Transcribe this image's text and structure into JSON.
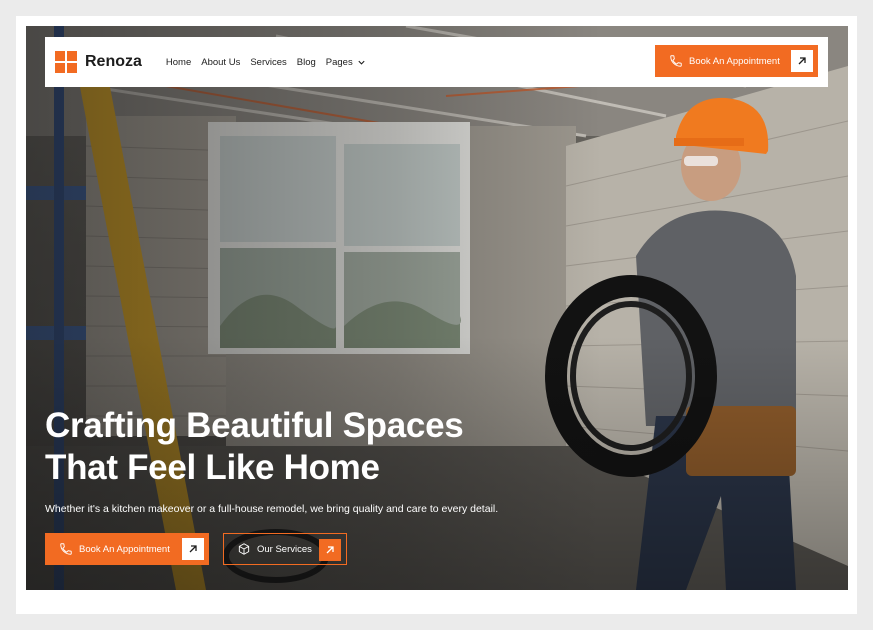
{
  "brand": {
    "name": "Renoza",
    "accent": "#f26b22"
  },
  "nav": {
    "items": [
      {
        "label": "Home"
      },
      {
        "label": "About Us"
      },
      {
        "label": "Services"
      },
      {
        "label": "Blog"
      },
      {
        "label": "Pages"
      }
    ],
    "cta_label": "Book An Appointment"
  },
  "hero": {
    "headline_line1": "Crafting Beautiful Spaces",
    "headline_line2": "That Feel Like Home",
    "subtext": "Whether it's a kitchen makeover or a full-house remodel, we bring quality and care to every detail.",
    "primary_cta": "Book An Appointment",
    "secondary_cta": "Our Services"
  },
  "icons": {
    "logo": "logo-grid-icon",
    "phone": "phone-icon",
    "arrow": "arrow-up-right-icon",
    "cube": "cube-icon",
    "chevron": "chevron-down-icon"
  }
}
